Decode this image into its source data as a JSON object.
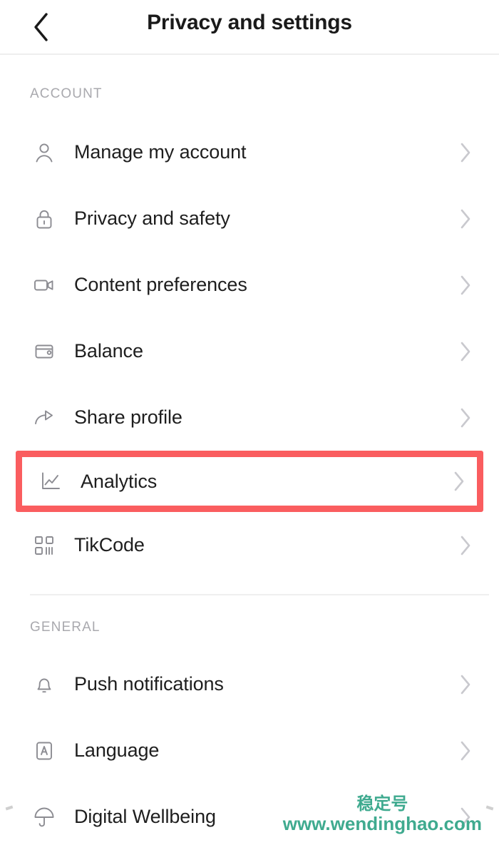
{
  "header": {
    "title": "Privacy and settings",
    "back_icon": "chevron-left-icon"
  },
  "sections": [
    {
      "key": "account",
      "label": "ACCOUNT",
      "items": [
        {
          "label": "Manage my account",
          "icon": "person-icon",
          "highlighted": false
        },
        {
          "label": "Privacy and safety",
          "icon": "lock-icon",
          "highlighted": false
        },
        {
          "label": "Content preferences",
          "icon": "video-icon",
          "highlighted": false
        },
        {
          "label": "Balance",
          "icon": "wallet-icon",
          "highlighted": false
        },
        {
          "label": "Share profile",
          "icon": "share-icon",
          "highlighted": false
        },
        {
          "label": "Analytics",
          "icon": "chart-icon",
          "highlighted": true
        },
        {
          "label": "TikCode",
          "icon": "qr-code-icon",
          "highlighted": false
        }
      ]
    },
    {
      "key": "general",
      "label": "GENERAL",
      "items": [
        {
          "label": "Push notifications",
          "icon": "bell-icon",
          "highlighted": false
        },
        {
          "label": "Language",
          "icon": "language-icon",
          "highlighted": false
        },
        {
          "label": "Digital Wellbeing",
          "icon": "umbrella-icon",
          "highlighted": false
        }
      ]
    }
  ],
  "row_chevron_icon": "chevron-right-icon",
  "highlight": {
    "target": "Analytics",
    "color": "#fa5d5f"
  },
  "watermark": {
    "chinese": "稳定号",
    "url": "www.wendinghao.com",
    "color": "#3faa8f"
  }
}
